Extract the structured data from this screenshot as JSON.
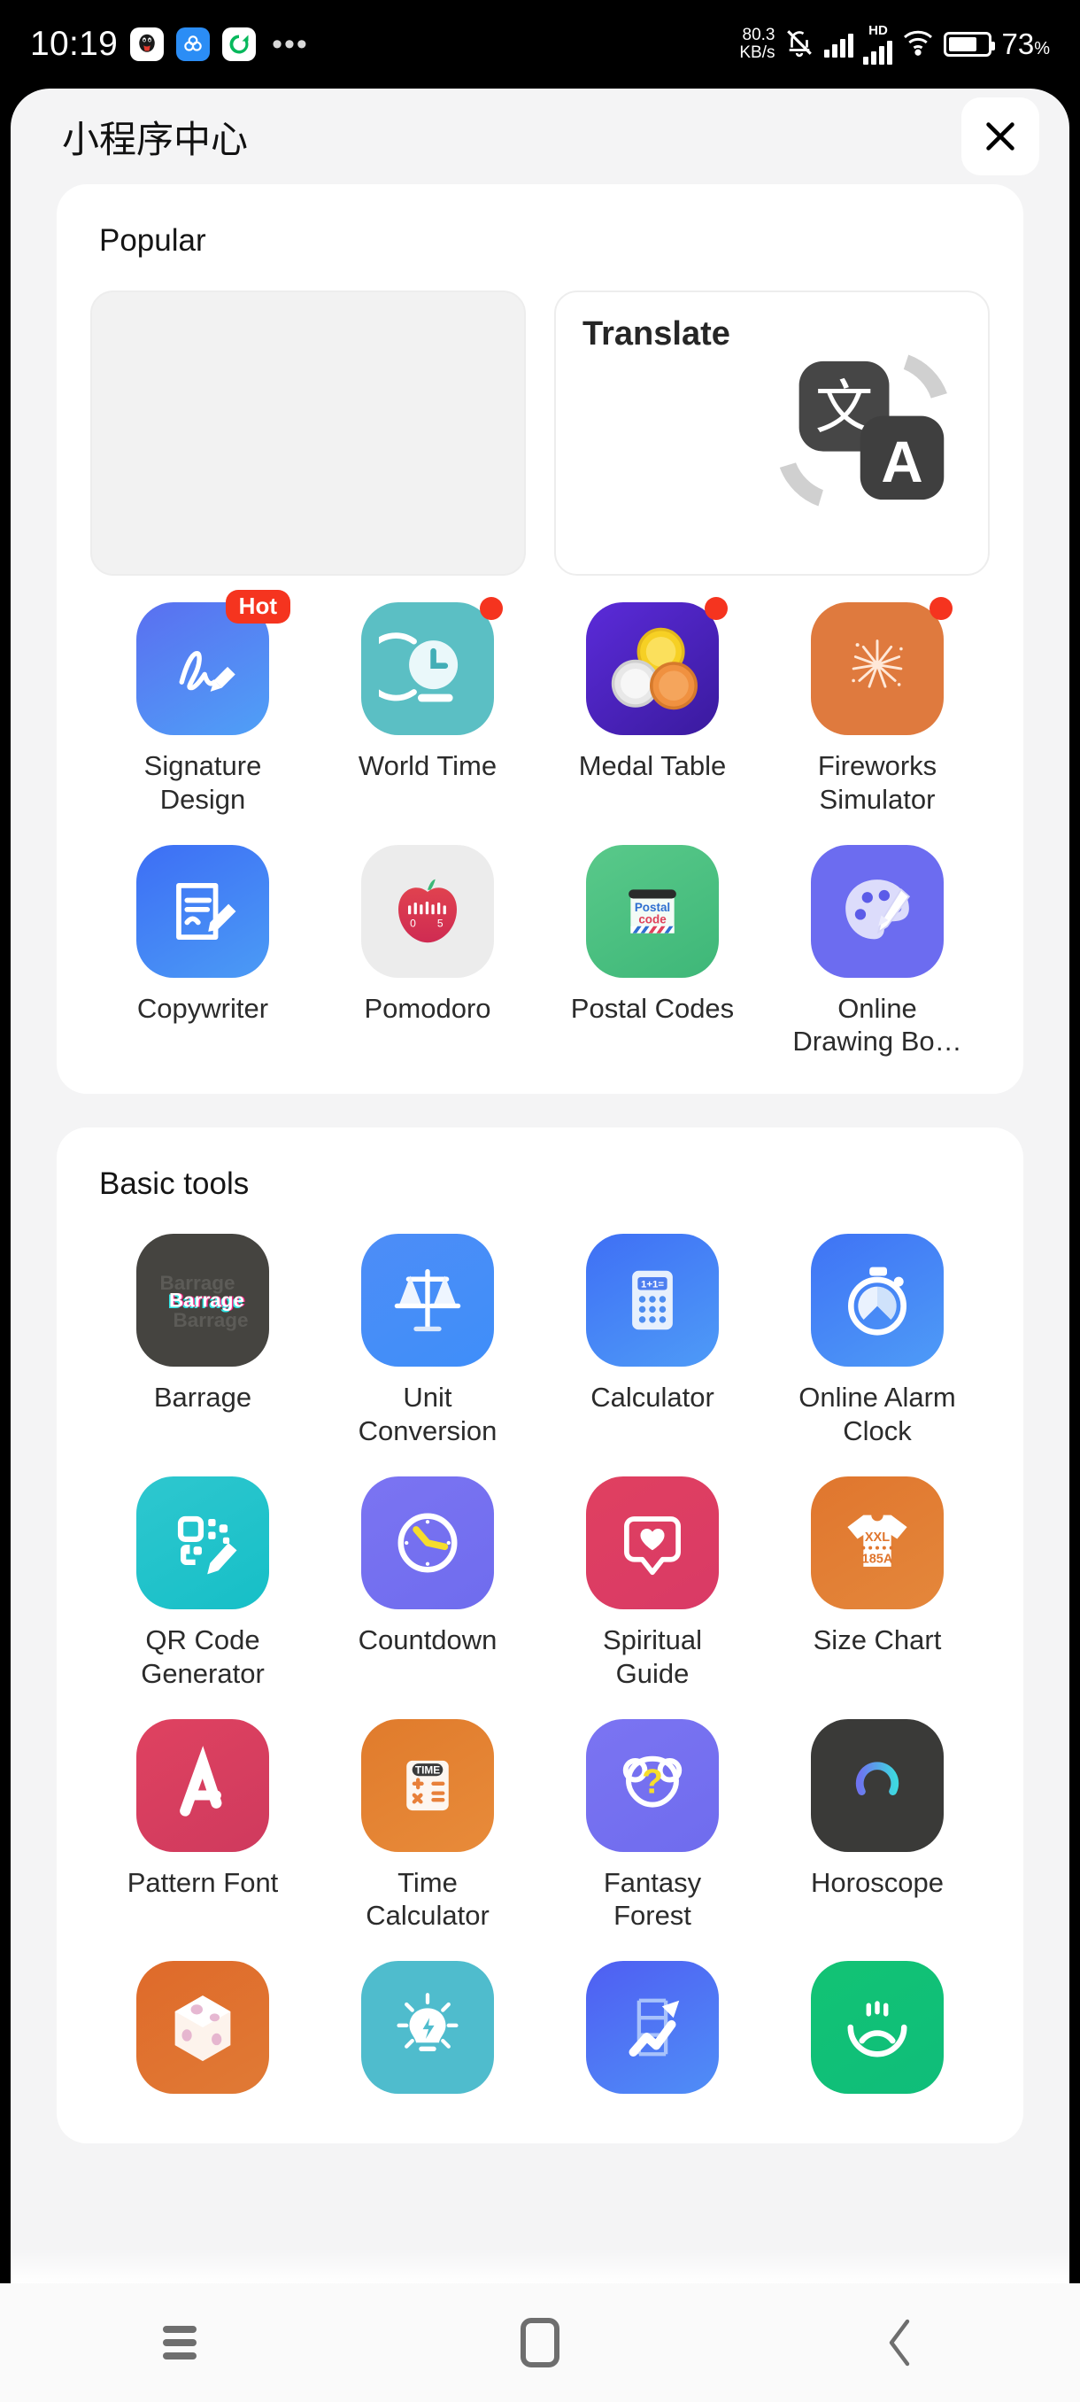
{
  "status_bar": {
    "time": "10:19",
    "app_icons": [
      "qq-icon",
      "blue-app-icon",
      "green-app-icon"
    ],
    "overflow": "•••",
    "net_speed_value": "80.3",
    "net_speed_unit": "KB/s",
    "mute_icon": "bell-muted-icon",
    "signal_label": "HD",
    "battery_percent": "73",
    "battery_percent_symbol": "%"
  },
  "header": {
    "title": "小程序中心",
    "close_label": "close-icon"
  },
  "sections": [
    {
      "title": "Popular",
      "banners": [
        {
          "label": "",
          "type": "placeholder"
        },
        {
          "label": "Translate",
          "type": "translate"
        }
      ],
      "apps": [
        {
          "label": "Signature Design",
          "icon": "signature-icon",
          "badge": "Hot"
        },
        {
          "label": "World Time",
          "icon": "world-time-icon",
          "badge": "dot"
        },
        {
          "label": "Medal Table",
          "icon": "medal-table-icon",
          "badge": "dot"
        },
        {
          "label": "Fireworks Simulator",
          "icon": "fireworks-icon",
          "badge": "dot"
        },
        {
          "label": "Copywriter",
          "icon": "copywriter-icon",
          "badge": ""
        },
        {
          "label": "Pomodoro",
          "icon": "pomodoro-icon",
          "badge": ""
        },
        {
          "label": "Postal Codes",
          "icon": "postal-code-icon",
          "badge": ""
        },
        {
          "label": "Online Drawing Bo…",
          "icon": "drawing-board-icon",
          "badge": ""
        }
      ]
    },
    {
      "title": "Basic tools",
      "apps": [
        {
          "label": "Barrage",
          "icon": "barrage-icon",
          "badge": ""
        },
        {
          "label": "Unit Conversion",
          "icon": "scales-icon",
          "badge": ""
        },
        {
          "label": "Calculator",
          "icon": "calculator-icon",
          "badge": ""
        },
        {
          "label": "Online Alarm Clock",
          "icon": "stopwatch-icon",
          "badge": ""
        },
        {
          "label": "QR Code Generator",
          "icon": "qr-code-icon",
          "badge": ""
        },
        {
          "label": "Countdown",
          "icon": "countdown-clock-icon",
          "badge": ""
        },
        {
          "label": "Spiritual Guide",
          "icon": "heart-bubble-icon",
          "badge": ""
        },
        {
          "label": "Size Chart",
          "icon": "tshirt-icon",
          "badge": ""
        },
        {
          "label": "Pattern Font",
          "icon": "pattern-font-icon",
          "badge": ""
        },
        {
          "label": "Time Calculator",
          "icon": "time-calculator-icon",
          "badge": ""
        },
        {
          "label": "Fantasy Forest",
          "icon": "bear-question-icon",
          "badge": ""
        },
        {
          "label": "Horoscope",
          "icon": "libra-icon",
          "badge": ""
        },
        {
          "label": "",
          "icon": "dice-icon",
          "badge": ""
        },
        {
          "label": "",
          "icon": "lightbulb-icon",
          "badge": ""
        },
        {
          "label": "",
          "icon": "growth-chart-icon",
          "badge": ""
        },
        {
          "label": "",
          "icon": "gauge-icon",
          "badge": ""
        }
      ]
    }
  ],
  "icon_art": {
    "translate_cn": "文",
    "translate_en": "A",
    "pomodoro_marks": [
      "0",
      "5"
    ],
    "postal_line1": "Postal",
    "postal_line2": "code",
    "calculator_display": "1+1=",
    "size_chart_line1": "XXL",
    "size_chart_line2": "185A",
    "time_calculator_label": "TIME",
    "barrage_text": "Barrage",
    "fantasy_mark": "?"
  },
  "nav_bar": {
    "menu": "menu-icon",
    "home": "home-icon",
    "back": "back-icon"
  },
  "colors": {
    "accent_red": "#f5341f",
    "sheet_bg": "#f4f4f5",
    "card_bg": "#ffffff",
    "text_primary": "#151515"
  }
}
